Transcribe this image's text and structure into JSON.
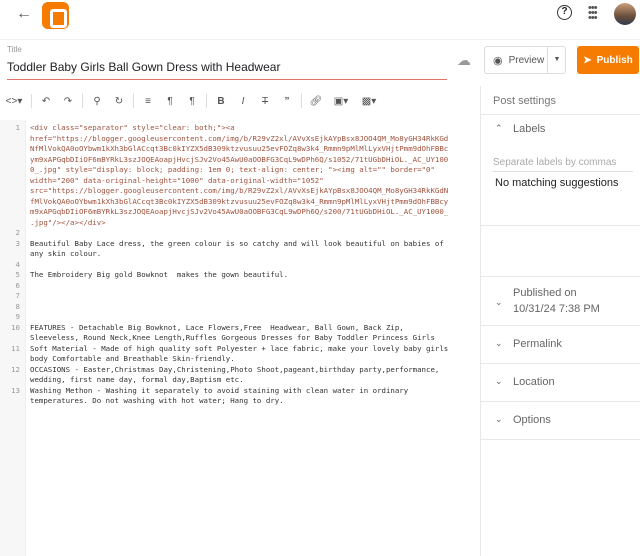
{
  "header": {
    "title_label": "Title",
    "title": "Toddler Baby Girls Ball Gown Dress with Headwear",
    "preview": "Preview",
    "publish": "Publish"
  },
  "toolbar": {
    "items": [
      "code-view",
      "undo",
      "redo",
      "search",
      "replace",
      "format",
      "ltr",
      "rtl",
      "bold",
      "italic",
      "strikethrough",
      "quote",
      "link",
      "image",
      "video"
    ]
  },
  "code_lines": [
    {
      "n": "1",
      "t": "<div class=\"separator\" style=\"clear: both;\"><a",
      "h": 1
    },
    {
      "n": "",
      "t": "href=\"https://blogger.googleusercontent.com/img/b/R29vZ2xl/AVvXsEjkAYpBsx8JOO4QM_Mo8yGH34RkKGd",
      "h": 1
    },
    {
      "n": "",
      "t": "NfMlVokQA0oOYbwm1kXh3bGlACcqt3Bc0kIYZX5dB309ktzvusuu25evFOZq8w3k4_Rmmn9pMlMlLyxVHjtPmm9dOhFBBc",
      "h": 1
    },
    {
      "n": "",
      "t": "ym9xAPGqbDIiOF6mBYRkL3szJOQEAoapjHvcjSJv2Vo45AwU0aOOBFG3CqL9wDPh6Q/s1052/71tUGbDHiOL._AC_UY100",
      "h": 1
    },
    {
      "n": "",
      "t": "0_.jpg\" style=\"display: block; padding: 1em 0; text-align: center; \"><img alt=\"\" border=\"0\"",
      "h": 1
    },
    {
      "n": "",
      "t": "width=\"200\" data-original-height=\"1000\" data-original-width=\"1052\"",
      "h": 1
    },
    {
      "n": "",
      "t": "src=\"https://blogger.googleusercontent.com/img/b/R29vZ2xl/AVvXsEjkAYpBsx8JOO4QM_Mo8yGH34RkKGdN",
      "h": 1
    },
    {
      "n": "",
      "t": "fMlVokQA0oOYbwm1kXh3bGlACcqt3Bc0kIYZX5dB309ktzvusuu25evFOZq8w3k4_Rmmn9pMlMlLyxVHjtPmm9dOhFBBcy",
      "h": 1
    },
    {
      "n": "",
      "t": "m9xAPGqbDIiOF6mBYRkL3szJOQEAoapjHvcjSJv2Vo45AwU0aOOBFG3CqL9wDPh6Q/s200/71tUGbDHiOL._AC_UY1000_",
      "h": 1
    },
    {
      "n": "",
      "t": ".jpg\"/></a></div>",
      "h": 1
    },
    {
      "n": "2",
      "t": ""
    },
    {
      "n": "3",
      "t": "Beautiful Baby Lace dress, the green colour is so catchy and will look beautiful on babies of"
    },
    {
      "n": "",
      "t": "any skin colour."
    },
    {
      "n": "4",
      "t": ""
    },
    {
      "n": "5",
      "t": "The Embroidery Big gold Bowknot  makes the gown beautiful."
    },
    {
      "n": "6",
      "t": ""
    },
    {
      "n": "7",
      "t": ""
    },
    {
      "n": "8",
      "t": ""
    },
    {
      "n": "9",
      "t": ""
    },
    {
      "n": "10",
      "t": "FEATURES - Detachable Big Bowknot, Lace Flowers,Free  Headwear, Ball Gown, Back Zip,"
    },
    {
      "n": "",
      "t": "Sleeveless, Round Neck,Knee Length,Ruffles Gorgeous Dresses for Baby Toddler Princess Girls"
    },
    {
      "n": "11",
      "t": "Soft Material - Made of high quality soft Polyester + lace fabric, make your lovely baby girls"
    },
    {
      "n": "",
      "t": "body Comfortable and Breathable Skin-friendly."
    },
    {
      "n": "12",
      "t": "OCCASIONS - Easter,Christmas Day,Christening,Photo Shoot,pageant,birthday party,performance,"
    },
    {
      "n": "",
      "t": "wedding, first name day, formal day,Baptism etc."
    },
    {
      "n": "13",
      "t": "Washing Methon - Washing it separately to avoid staining with clean water in ordinary"
    },
    {
      "n": "",
      "t": "temperatures. Do not washing with hot water; Hang to dry."
    }
  ],
  "sidebar": {
    "title": "Post settings",
    "labels": "Labels",
    "labels_placeholder": "Separate labels by commas",
    "no_match": "No matching suggestions",
    "published_on": "Published on",
    "published_date": "10/31/24 7:38 PM",
    "permalink": "Permalink",
    "location": "Location",
    "options": "Options"
  },
  "colors": {
    "accent": "#f57c00",
    "code_tag": "#a0523d"
  }
}
